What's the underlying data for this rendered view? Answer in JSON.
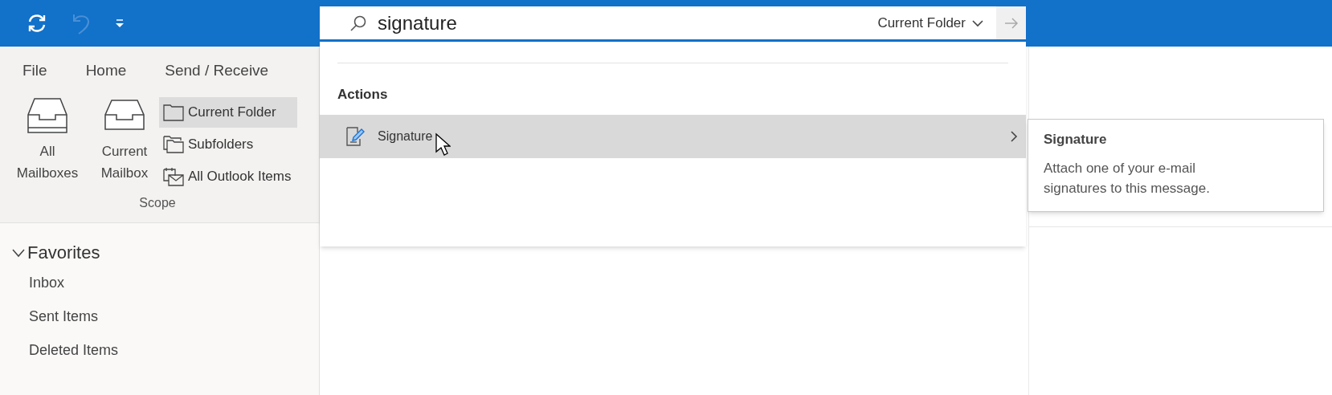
{
  "quick_access": [
    {
      "kind": "refresh",
      "disabled": false
    },
    {
      "kind": "undo",
      "disabled": true
    },
    {
      "kind": "customize",
      "disabled": false
    }
  ],
  "search": {
    "value": "signature",
    "scope": "Current Folder"
  },
  "ribbon": {
    "tabs": [
      "File",
      "Home",
      "Send / Receive"
    ],
    "scope_group": {
      "label": "Scope",
      "large_buttons": [
        {
          "label": "All Mailboxes",
          "kind": "all"
        },
        {
          "label": "Current Mailbox",
          "kind": "current"
        }
      ],
      "small_buttons": [
        {
          "label": "Current Folder",
          "kind": "folder",
          "selected": true
        },
        {
          "label": "Subfolders",
          "kind": "subfolders",
          "selected": false
        },
        {
          "label": "All Outlook Items",
          "kind": "all-items",
          "selected": false
        }
      ]
    }
  },
  "favorites": {
    "label": "Favorites",
    "expanded": true,
    "items": [
      "Inbox",
      "Sent Items",
      "Deleted Items"
    ]
  },
  "dropdown": {
    "sections": [
      {
        "heading": "Actions",
        "items": [
          {
            "label": "Signature",
            "selected": true
          }
        ]
      }
    ]
  },
  "tooltip": {
    "title": "Signature",
    "description": "Attach one of your e-mail signatures to this message."
  }
}
